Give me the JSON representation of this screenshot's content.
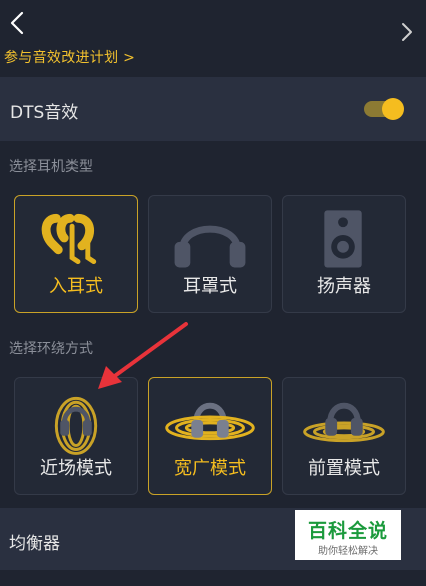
{
  "header": {
    "back_icon": "chevron-left-icon",
    "join_link": "参与音效改进计划 >"
  },
  "dts": {
    "label": "DTS音效",
    "enabled": true,
    "toggle_color": "#f5bd1f"
  },
  "headphone_section": {
    "label": "选择耳机类型",
    "options": [
      {
        "label": "入耳式",
        "icon": "in-ear-icon",
        "selected": true
      },
      {
        "label": "耳罩式",
        "icon": "over-ear-headphones-icon",
        "selected": false
      },
      {
        "label": "扬声器",
        "icon": "speaker-icon",
        "selected": false
      }
    ]
  },
  "surround_section": {
    "label": "选择环绕方式",
    "options": [
      {
        "label": "近场模式",
        "icon": "near-field-icon",
        "selected": false
      },
      {
        "label": "宽广模式",
        "icon": "wide-mode-icon",
        "selected": true
      },
      {
        "label": "前置模式",
        "icon": "front-mode-icon",
        "selected": false
      }
    ]
  },
  "equalizer": {
    "label": "均衡器",
    "chevron_icon": "chevron-right-icon"
  },
  "watermark": {
    "title": "百科全说",
    "subtitle": "助你轻松解决"
  },
  "annotation": {
    "arrow_color": "#e8333a"
  },
  "colors": {
    "accent": "#f5bd1f",
    "background": "#1f2430",
    "row_background": "#2a3040"
  }
}
